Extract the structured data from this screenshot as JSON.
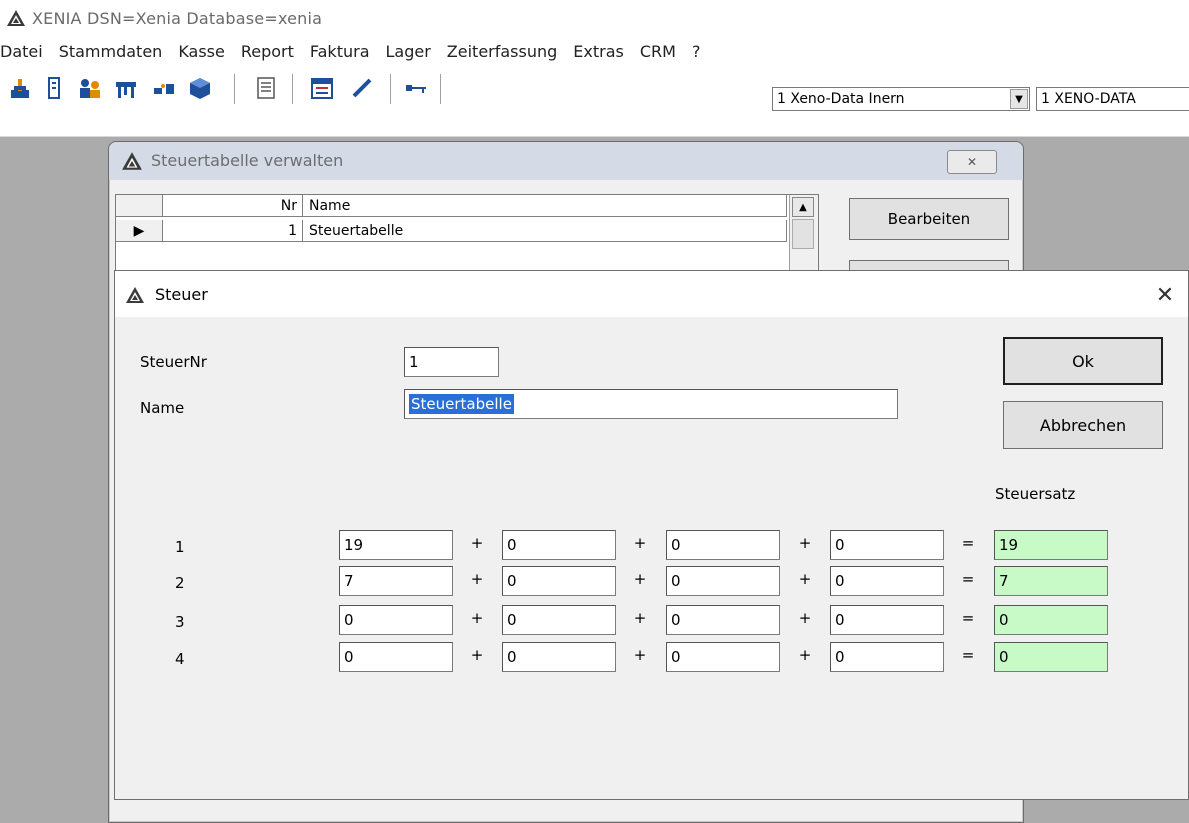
{
  "app": {
    "title": "XENIA  DSN=Xenia  Database=xenia"
  },
  "menu": [
    "Datei",
    "Stammdaten",
    "Kasse",
    "Report",
    "Faktura",
    "Lager",
    "Zeiterfassung",
    "Extras",
    "CRM",
    "?"
  ],
  "toolbar": {
    "combo1": "1 Xeno-Data Inern",
    "combo2": "1 XENO-DATA"
  },
  "bg_window": {
    "title": "Steuertabelle verwalten",
    "columns": [
      "Nr",
      "Name"
    ],
    "rows": [
      {
        "nr": "1",
        "name": "Steuertabelle"
      }
    ],
    "edit_button": "Bearbeiten"
  },
  "dialog": {
    "title": "Steuer",
    "steuernr_label": "SteuerNr",
    "steuernr_value": "1",
    "name_label": "Name",
    "name_value": "Steuertabelle",
    "ok_button": "Ok",
    "cancel_button": "Abbrechen",
    "rate_header": "Steuersatz",
    "plus": "+",
    "equals": "=",
    "rows": [
      {
        "label": "1",
        "a": "19",
        "b": "0",
        "c": "0",
        "d": "0",
        "total": "19"
      },
      {
        "label": "2",
        "a": "7",
        "b": "0",
        "c": "0",
        "d": "0",
        "total": "7"
      },
      {
        "label": "3",
        "a": "0",
        "b": "0",
        "c": "0",
        "d": "0",
        "total": "0"
      },
      {
        "label": "4",
        "a": "0",
        "b": "0",
        "c": "0",
        "d": "0",
        "total": "0"
      }
    ]
  }
}
